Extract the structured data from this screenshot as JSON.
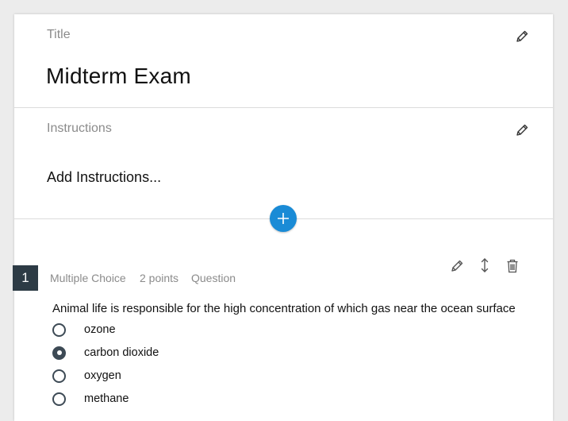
{
  "title_section": {
    "label": "Title",
    "value": "Midterm Exam"
  },
  "instructions_section": {
    "label": "Instructions",
    "value": "Add Instructions..."
  },
  "question": {
    "number": "1",
    "type": "Multiple Choice",
    "points": "2 points",
    "kind": "Question",
    "text": "Animal life is responsible for the high concentration of which gas near the ocean surface",
    "choices": [
      {
        "label": "ozone",
        "selected": false
      },
      {
        "label": "carbon dioxide",
        "selected": true
      },
      {
        "label": "oxygen",
        "selected": false
      },
      {
        "label": "methane",
        "selected": false
      }
    ]
  },
  "icons": {
    "edit": "pencil-icon",
    "reorder": "up-down-arrow-icon",
    "delete": "trash-icon",
    "add": "plus-icon"
  },
  "colors": {
    "accent": "#1a8bd6",
    "number_badge": "#2d3b45",
    "muted_text": "#8b8b8b"
  }
}
